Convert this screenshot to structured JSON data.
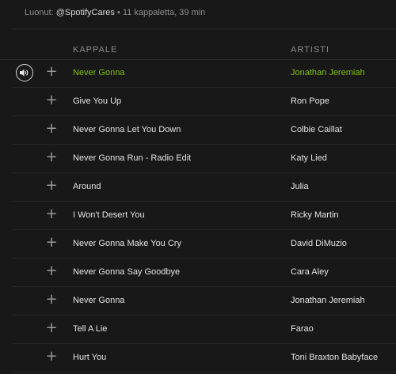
{
  "playlist": {
    "owner_prefix": "Luonut:",
    "owner": "@SpotifyCares",
    "summary": "• 11 kappaletta, 39 min"
  },
  "header": {
    "title_col": "KAPPALE",
    "artist_col": "ARTISTI"
  },
  "accent_color": "#84bd00",
  "tracks": [
    {
      "title": "Never Gonna",
      "artist": "Jonathan Jeremiah",
      "playing": true
    },
    {
      "title": "Give You Up",
      "artist": "Ron Pope"
    },
    {
      "title": "Never Gonna Let You Down",
      "artist": "Colbie Caillat"
    },
    {
      "title": "Never Gonna Run - Radio Edit",
      "artist": "Katy Lied"
    },
    {
      "title": "Around",
      "artist": "Julia"
    },
    {
      "title": "I Won't Desert You",
      "artist": "Ricky Martin"
    },
    {
      "title": "Never Gonna Make You Cry",
      "artist": "David DiMuzio"
    },
    {
      "title": "Never Gonna Say Goodbye",
      "artist": "Cara Aley"
    },
    {
      "title": "Never Gonna",
      "artist": "Jonathan Jeremiah"
    },
    {
      "title": "Tell A Lie",
      "artist": "Farao"
    },
    {
      "title": "Hurt You",
      "artist": "Toni Braxton Babyface"
    }
  ],
  "icons": {
    "add": "plus-icon",
    "now_playing": "speaker-icon"
  },
  "add_glyph": "+"
}
